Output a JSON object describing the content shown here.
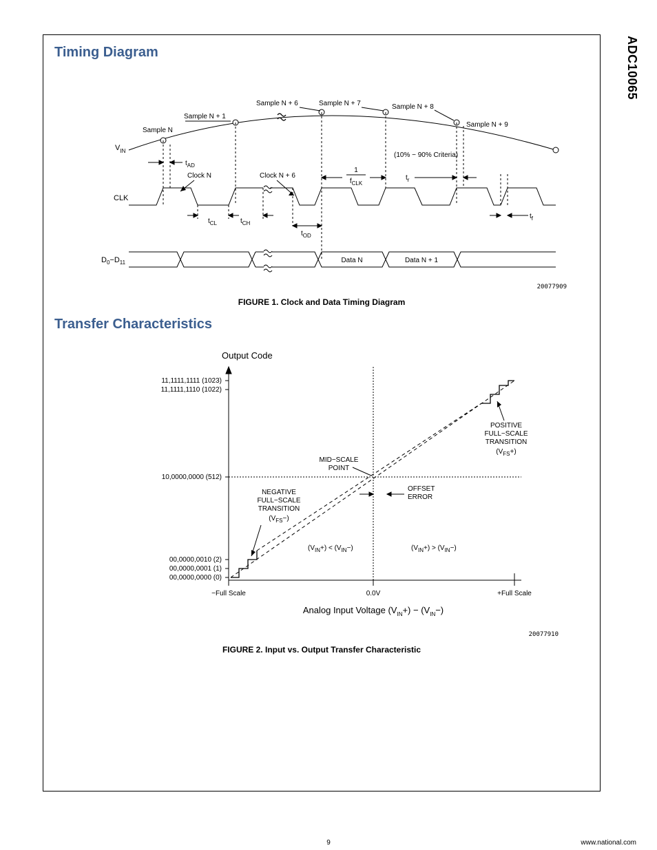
{
  "sidebar_part": "ADC10065",
  "section1_title": "Timing Diagram",
  "fig1": {
    "caption": "FIGURE 1. Clock and Data Timing Diagram",
    "id": "20077909",
    "labels": {
      "sample_n": "Sample N",
      "sample_n1": "Sample N + 1",
      "sample_n6": "Sample N + 6",
      "sample_n7": "Sample N + 7",
      "sample_n8": "Sample N + 8",
      "sample_n9": "Sample N + 9",
      "vin": "V",
      "vin_sub": "IN",
      "clk": "CLK",
      "d0d11": "D",
      "d0d11_sub0": "0",
      "d0d11_dash": "−D",
      "d0d11_sub1": "11",
      "clock_n": "Clock N",
      "clock_n6": "Clock N + 6",
      "t_ad": "t",
      "t_ad_sub": "AD",
      "t_cl": "t",
      "t_cl_sub": "CL",
      "t_ch": "t",
      "t_ch_sub": "CH",
      "t_od": "t",
      "t_od_sub": "OD",
      "t_r": "t",
      "t_r_sub": "r",
      "t_f": "t",
      "t_f_sub": "f",
      "one_over": "1",
      "fclk": "f",
      "fclk_sub": "CLK",
      "criteria": "(10% − 90% Criteria)",
      "data_n": "Data N",
      "data_n1": "Data N + 1"
    }
  },
  "section2_title": "Transfer Characteristics",
  "fig2": {
    "caption": "FIGURE 2. Input vs. Output Transfer Characteristic",
    "id": "20077910",
    "labels": {
      "output_code": "Output Code",
      "code_1023": "11,1111,1111 (1023)",
      "code_1022": "11,1111,1110 (1022)",
      "code_512": "10,0000,0000 (512)",
      "code_2": "00,0000,0010 (2)",
      "code_1": "00,0000,0001 (1)",
      "code_0": "00,0000,0000 (0)",
      "mid_scale_1": "MID−SCALE",
      "mid_scale_2": "POINT",
      "neg_full_1": "NEGATIVE",
      "neg_full_2": "FULL−SCALE",
      "neg_full_3": "TRANSITION",
      "neg_full_4": "(V",
      "neg_full_4_sub": "FS",
      "neg_full_4_tail": "−)",
      "pos_full_1": "POSITIVE",
      "pos_full_2": "FULL−SCALE",
      "pos_full_3": "TRANSITION",
      "pos_full_4": "(V",
      "pos_full_4_sub": "FS",
      "pos_full_4_tail": "+)",
      "offset_1": "OFFSET",
      "offset_2": "ERROR",
      "cond_left": "(V",
      "cond_left_sub1": "IN",
      "cond_left_mid": "+) < (V",
      "cond_left_sub2": "IN",
      "cond_left_tail": "−)",
      "cond_right": "(V",
      "cond_right_sub1": "IN",
      "cond_right_mid": "+) > (V",
      "cond_right_sub2": "IN",
      "cond_right_tail": "−)",
      "minus_full": "−Full Scale",
      "zero_v": "0.0V",
      "plus_full": "+Full Scale",
      "xlabel_pre": "Analog Input Voltage (V",
      "xlabel_sub1": "IN",
      "xlabel_mid": "+) − (V",
      "xlabel_sub2": "IN",
      "xlabel_tail": "−)"
    }
  },
  "page_number": "9",
  "site_url": "www.national.com"
}
